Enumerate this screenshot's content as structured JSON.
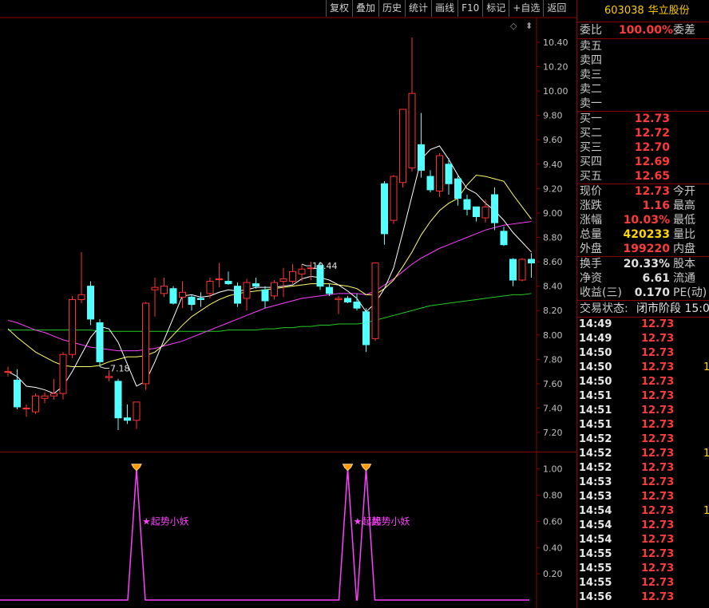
{
  "toolbar": {
    "items": [
      "复权",
      "叠加",
      "历史",
      "统计",
      "画线",
      "F10",
      "标记",
      "+自选",
      "返回"
    ]
  },
  "icons": {
    "corner": "diamond-outline-icon",
    "scroll": "scroll-icon"
  },
  "colors": {
    "up": "#ff3232",
    "down": "#54ffff",
    "ma5": "#ffffff",
    "ma10": "#ffff66",
    "ma20": "#ff40ff",
    "ma60": "#22cc22",
    "signal": "#ff40ff",
    "axis": "#8b0000",
    "marker": "#ff9900"
  },
  "chart_data": [
    {
      "type": "candlestick",
      "ylim": [
        7.05,
        10.55
      ],
      "y_ticks": [
        "10.40",
        "10.20",
        "10.00",
        "9.80",
        "9.60",
        "9.40",
        "9.20",
        "9.00",
        "8.80",
        "8.60",
        "8.40",
        "8.20",
        "8.00",
        "7.80",
        "7.60",
        "7.40",
        "7.20"
      ],
      "annotations": [
        {
          "text": "10.44",
          "index": 32
        },
        {
          "text": "7.18",
          "index": 10
        }
      ],
      "candles": [
        [
          7.7,
          7.74,
          7.66,
          7.7
        ],
        [
          7.63,
          7.72,
          7.39,
          7.41
        ],
        [
          7.4,
          7.43,
          7.33,
          7.4
        ],
        [
          7.37,
          7.52,
          7.35,
          7.5
        ],
        [
          7.48,
          7.53,
          7.44,
          7.5
        ],
        [
          7.5,
          7.64,
          7.47,
          7.52
        ],
        [
          7.52,
          7.86,
          7.47,
          7.84
        ],
        [
          7.84,
          8.32,
          7.81,
          8.29
        ],
        [
          8.29,
          8.68,
          8.26,
          8.33
        ],
        [
          8.4,
          8.44,
          8.08,
          8.13
        ],
        [
          8.1,
          8.13,
          7.74,
          7.78
        ],
        [
          7.65,
          7.71,
          7.62,
          7.66
        ],
        [
          7.62,
          7.64,
          7.22,
          7.32
        ],
        [
          7.32,
          7.43,
          7.27,
          7.3
        ],
        [
          7.3,
          7.45,
          7.23,
          7.45
        ],
        [
          7.6,
          8.27,
          7.55,
          8.26
        ],
        [
          8.37,
          8.47,
          8.15,
          8.39
        ],
        [
          8.34,
          8.47,
          8.31,
          8.4
        ],
        [
          8.38,
          8.4,
          8.25,
          8.26
        ],
        [
          8.31,
          8.44,
          8.22,
          8.35
        ],
        [
          8.31,
          8.33,
          8.2,
          8.25
        ],
        [
          8.3,
          8.35,
          8.23,
          8.29
        ],
        [
          8.34,
          8.47,
          8.3,
          8.44
        ],
        [
          8.46,
          8.59,
          8.39,
          8.46
        ],
        [
          8.44,
          8.52,
          8.41,
          8.42
        ],
        [
          8.4,
          8.43,
          8.23,
          8.26
        ],
        [
          8.3,
          8.46,
          8.2,
          8.43
        ],
        [
          8.42,
          8.47,
          8.38,
          8.4
        ],
        [
          8.37,
          8.4,
          8.22,
          8.28
        ],
        [
          8.32,
          8.45,
          8.29,
          8.43
        ],
        [
          8.44,
          8.55,
          8.31,
          8.46
        ],
        [
          8.44,
          8.58,
          8.42,
          8.52
        ],
        [
          8.5,
          8.58,
          8.44,
          8.54
        ],
        [
          8.55,
          8.6,
          8.45,
          8.55
        ],
        [
          8.57,
          8.6,
          8.37,
          8.4
        ],
        [
          8.39,
          8.42,
          8.32,
          8.34
        ],
        [
          8.29,
          8.32,
          8.17,
          8.3
        ],
        [
          8.3,
          8.32,
          8.26,
          8.27
        ],
        [
          8.27,
          8.34,
          8.2,
          8.22
        ],
        [
          8.19,
          8.22,
          7.86,
          7.92
        ],
        [
          7.97,
          8.58,
          7.95,
          8.59
        ],
        [
          9.24,
          9.26,
          8.74,
          8.83
        ],
        [
          8.94,
          9.31,
          8.91,
          9.3
        ],
        [
          9.25,
          9.84,
          9.21,
          9.85
        ],
        [
          9.37,
          10.44,
          9.34,
          9.98
        ],
        [
          9.56,
          9.82,
          9.29,
          9.35
        ],
        [
          9.3,
          9.35,
          9.17,
          9.19
        ],
        [
          9.18,
          9.49,
          9.13,
          9.47
        ],
        [
          9.4,
          9.45,
          9.15,
          9.24
        ],
        [
          9.28,
          9.31,
          9.06,
          9.12
        ],
        [
          9.11,
          9.15,
          8.98,
          9.03
        ],
        [
          9.05,
          9.05,
          8.93,
          8.97
        ],
        [
          8.96,
          9.11,
          8.92,
          9.05
        ],
        [
          9.15,
          9.21,
          8.86,
          8.92
        ],
        [
          8.85,
          8.89,
          8.73,
          8.74
        ],
        [
          8.62,
          8.63,
          8.4,
          8.45
        ],
        [
          8.45,
          8.63,
          8.44,
          8.62
        ],
        [
          8.62,
          8.67,
          8.47,
          8.59
        ]
      ],
      "ma5": [
        7.7,
        7.66,
        7.58,
        7.57,
        7.55,
        7.52,
        7.58,
        7.7,
        7.84,
        7.98,
        8.07,
        8.05,
        7.94,
        7.76,
        7.58,
        7.62,
        7.78,
        7.96,
        8.14,
        8.32,
        8.33,
        8.31,
        8.32,
        8.35,
        8.37,
        8.36,
        8.37,
        8.39,
        8.39,
        8.39,
        8.4,
        8.41,
        8.46,
        8.48,
        8.47,
        8.45,
        8.41,
        8.36,
        8.3,
        8.19,
        8.26,
        8.38,
        8.55,
        8.84,
        9.14,
        9.44,
        9.52,
        9.55,
        9.44,
        9.31,
        9.2,
        9.16,
        9.08,
        9.02,
        8.94,
        8.84,
        8.76,
        8.68
      ],
      "ma10": [
        8.05,
        7.98,
        7.92,
        7.86,
        7.82,
        7.78,
        7.75,
        7.74,
        7.74,
        7.74,
        7.75,
        7.78,
        7.8,
        7.82,
        7.82,
        7.83,
        7.86,
        7.92,
        8.0,
        8.08,
        8.15,
        8.2,
        8.25,
        8.29,
        8.32,
        8.34,
        8.35,
        8.36,
        8.37,
        8.38,
        8.39,
        8.4,
        8.41,
        8.42,
        8.42,
        8.42,
        8.41,
        8.4,
        8.38,
        8.33,
        8.33,
        8.38,
        8.45,
        8.56,
        8.68,
        8.82,
        8.93,
        9.02,
        9.08,
        9.12,
        9.23,
        9.31,
        9.3,
        9.28,
        9.26,
        9.15,
        9.05,
        8.95
      ],
      "ma20": [
        8.12,
        8.1,
        8.07,
        8.04,
        8.02,
        7.99,
        7.96,
        7.94,
        7.92,
        7.9,
        7.89,
        7.88,
        7.87,
        7.87,
        7.87,
        7.88,
        7.89,
        7.91,
        7.93,
        7.95,
        7.98,
        8.01,
        8.04,
        8.07,
        8.1,
        8.13,
        8.16,
        8.19,
        8.22,
        8.24,
        8.26,
        8.28,
        8.3,
        8.31,
        8.32,
        8.33,
        8.34,
        8.34,
        8.34,
        8.33,
        8.36,
        8.41,
        8.46,
        8.52,
        8.58,
        8.63,
        8.67,
        8.71,
        8.74,
        8.77,
        8.8,
        8.83,
        8.86,
        8.88,
        8.9,
        8.91,
        8.92,
        8.93
      ],
      "ma60": [
        8.04,
        8.04,
        8.04,
        8.04,
        8.04,
        8.04,
        8.04,
        8.04,
        8.04,
        8.04,
        8.03,
        8.03,
        8.03,
        8.03,
        8.03,
        8.03,
        8.03,
        8.03,
        8.03,
        8.03,
        8.03,
        8.03,
        8.03,
        8.03,
        8.04,
        8.04,
        8.04,
        8.04,
        8.05,
        8.05,
        8.06,
        8.06,
        8.07,
        8.07,
        8.08,
        8.08,
        8.09,
        8.09,
        8.09,
        8.1,
        8.12,
        8.14,
        8.16,
        8.18,
        8.2,
        8.22,
        8.24,
        8.25,
        8.26,
        8.27,
        8.28,
        8.29,
        8.3,
        8.31,
        8.32,
        8.33,
        8.33,
        8.34
      ]
    },
    {
      "type": "line",
      "ylim": [
        0,
        1.12
      ],
      "y_ticks": [
        "1.00",
        "0.80",
        "0.60",
        "0.40",
        "0.20"
      ],
      "signal_indices": [
        14,
        37,
        39
      ],
      "labels": [
        {
          "text": "★起势小妖",
          "index": 14
        },
        {
          "text": "★起势",
          "index": 37
        },
        {
          "text": "起势小妖",
          "index": 39
        }
      ]
    }
  ],
  "quote": {
    "code": "603038",
    "name": "华立股份",
    "weibi_label": "委比",
    "weibi_value": "100.00%",
    "weicha_label": "委差",
    "sell": [
      {
        "label": "卖五",
        "price": ""
      },
      {
        "label": "卖四",
        "price": ""
      },
      {
        "label": "卖三",
        "price": ""
      },
      {
        "label": "卖二",
        "price": ""
      },
      {
        "label": "卖一",
        "price": ""
      }
    ],
    "buy": [
      {
        "label": "买一",
        "price": "12.73"
      },
      {
        "label": "买二",
        "price": "12.72"
      },
      {
        "label": "买三",
        "price": "12.70"
      },
      {
        "label": "买四",
        "price": "12.69"
      },
      {
        "label": "买五",
        "price": "12.65"
      }
    ],
    "stats": [
      {
        "label": "现价",
        "value": "12.73",
        "label2": "今开",
        "color": "red"
      },
      {
        "label": "涨跌",
        "value": "1.16",
        "label2": "最高",
        "color": "red"
      },
      {
        "label": "涨幅",
        "value": "10.03%",
        "label2": "最低",
        "color": "red"
      },
      {
        "label": "总量",
        "value": "420233",
        "label2": "量比",
        "color": "yel"
      },
      {
        "label": "外盘",
        "value": "199220",
        "label2": "内盘",
        "color": "red"
      }
    ],
    "stats2": [
      {
        "label": "换手",
        "value": "20.33%",
        "label2": "股本",
        "color": "wht"
      },
      {
        "label": "净资",
        "value": "6.61",
        "label2": "流通",
        "color": "wht"
      },
      {
        "label": "收益(三)",
        "value": "0.170",
        "label2": "PE(动)",
        "color": "wht"
      }
    ],
    "trade_status_label": "交易状态:",
    "trade_status_value": "闭市阶段 15:0",
    "ticks": [
      {
        "t": "14:49",
        "p": "12.73",
        "v": ""
      },
      {
        "t": "14:49",
        "p": "12.73",
        "v": ""
      },
      {
        "t": "14:50",
        "p": "12.73",
        "v": ""
      },
      {
        "t": "14:50",
        "p": "12.73",
        "v": "1"
      },
      {
        "t": "14:50",
        "p": "12.73",
        "v": ""
      },
      {
        "t": "14:51",
        "p": "12.73",
        "v": ""
      },
      {
        "t": "14:51",
        "p": "12.73",
        "v": ""
      },
      {
        "t": "14:51",
        "p": "12.73",
        "v": ""
      },
      {
        "t": "14:52",
        "p": "12.73",
        "v": ""
      },
      {
        "t": "14:52",
        "p": "12.73",
        "v": "1"
      },
      {
        "t": "14:52",
        "p": "12.73",
        "v": ""
      },
      {
        "t": "14:53",
        "p": "12.73",
        "v": ""
      },
      {
        "t": "14:53",
        "p": "12.73",
        "v": ""
      },
      {
        "t": "14:54",
        "p": "12.73",
        "v": "1"
      },
      {
        "t": "14:54",
        "p": "12.73",
        "v": ""
      },
      {
        "t": "14:54",
        "p": "12.73",
        "v": ""
      },
      {
        "t": "14:55",
        "p": "12.73",
        "v": ""
      },
      {
        "t": "14:55",
        "p": "12.73",
        "v": ""
      },
      {
        "t": "14:55",
        "p": "12.73",
        "v": ""
      },
      {
        "t": "14:56",
        "p": "12.73",
        "v": ""
      }
    ]
  }
}
